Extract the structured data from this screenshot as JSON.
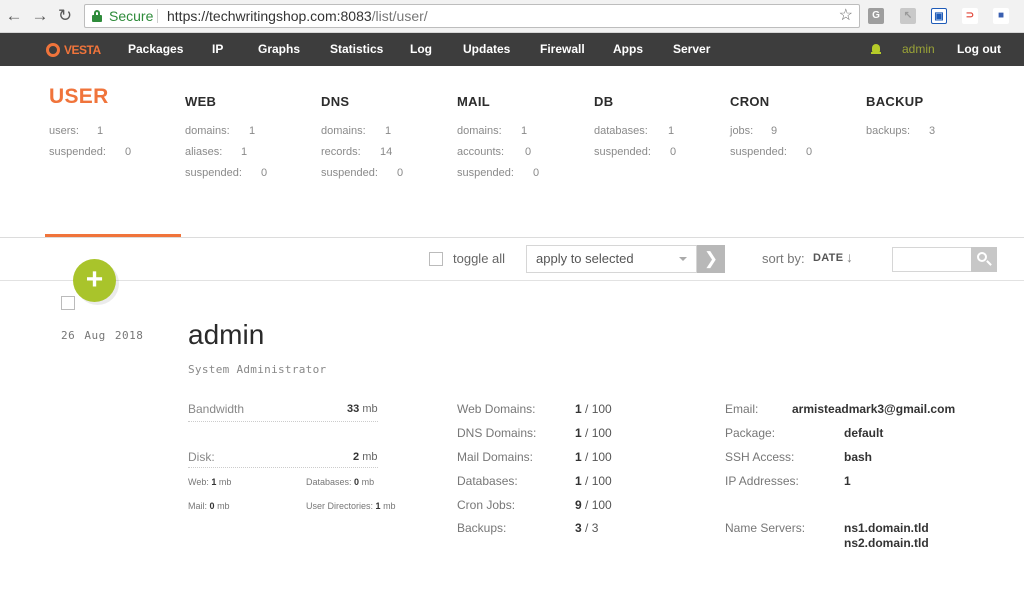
{
  "browser": {
    "secure_label": "Secure",
    "url_host": "https://techwritingshop.com:8083",
    "url_path": "/list/user/",
    "ext_icons": [
      "G",
      "↖",
      "▣",
      "⊃",
      "■"
    ]
  },
  "nav": {
    "logo": "VESTA",
    "items": [
      "Packages",
      "IP",
      "Graphs",
      "Statistics",
      "Log",
      "Updates",
      "Firewall",
      "Apps",
      "Server"
    ],
    "user": "admin",
    "logout": "Log out"
  },
  "stats": {
    "user": {
      "title": "USER",
      "rows": [
        {
          "label": "users:",
          "value": "1"
        },
        {
          "label": "suspended:",
          "value": "0"
        }
      ]
    },
    "web": {
      "title": "WEB",
      "rows": [
        {
          "label": "domains:",
          "value": "1"
        },
        {
          "label": "aliases:",
          "value": "1"
        },
        {
          "label": "suspended:",
          "value": "0"
        }
      ]
    },
    "dns": {
      "title": "DNS",
      "rows": [
        {
          "label": "domains:",
          "value": "1"
        },
        {
          "label": "records:",
          "value": "14"
        },
        {
          "label": "suspended:",
          "value": "0"
        }
      ]
    },
    "mail": {
      "title": "MAIL",
      "rows": [
        {
          "label": "domains:",
          "value": "1"
        },
        {
          "label": "accounts:",
          "value": "0"
        },
        {
          "label": "suspended:",
          "value": "0"
        }
      ]
    },
    "db": {
      "title": "DB",
      "rows": [
        {
          "label": "databases:",
          "value": "1"
        },
        {
          "label": "suspended:",
          "value": "0"
        }
      ]
    },
    "cron": {
      "title": "CRON",
      "rows": [
        {
          "label": "jobs:",
          "value": "9"
        },
        {
          "label": "suspended:",
          "value": "0"
        }
      ]
    },
    "backup": {
      "title": "BACKUP",
      "rows": [
        {
          "label": "backups:",
          "value": "3"
        }
      ]
    }
  },
  "toolbar": {
    "toggle_all": "toggle all",
    "apply_select": "apply to selected",
    "sort_label": "sort by:",
    "sort_value": "DATE",
    "sort_arrow": "↓"
  },
  "record": {
    "date": "26 Aug 2018",
    "username": "admin",
    "fullname": "System Administrator",
    "bandwidth": {
      "label": "Bandwidth",
      "value": "33",
      "unit": "mb"
    },
    "disk": {
      "label": "Disk:",
      "value": "2",
      "unit": "mb"
    },
    "disk_breakdown": {
      "web": {
        "label": "Web:",
        "value": "1",
        "unit": "mb"
      },
      "databases": {
        "label": "Databases:",
        "value": "0",
        "unit": "mb"
      },
      "mail": {
        "label": "Mail:",
        "value": "0",
        "unit": "mb"
      },
      "user_dirs": {
        "label": "User Directories:",
        "value": "1",
        "unit": "mb"
      }
    },
    "limits": [
      {
        "label": "Web Domains:",
        "used": "1",
        "total": "/ 100"
      },
      {
        "label": "DNS Domains:",
        "used": "1",
        "total": "/ 100"
      },
      {
        "label": "Mail Domains:",
        "used": "1",
        "total": "/ 100"
      },
      {
        "label": "Databases:",
        "used": "1",
        "total": "/ 100"
      },
      {
        "label": "Cron Jobs:",
        "used": "9",
        "total": "/ 100"
      },
      {
        "label": "Backups:",
        "used": "3",
        "total": "/ 3"
      }
    ],
    "info": {
      "email": {
        "label": "Email:",
        "value": "armisteadmark3@gmail.com"
      },
      "package": {
        "label": "Package:",
        "value": "default"
      },
      "ssh": {
        "label": "SSH Access:",
        "value": "bash"
      },
      "ip": {
        "label": "IP Addresses:",
        "value": "1"
      },
      "ns": {
        "label": "Name Servers:",
        "values": [
          "ns1.domain.tld",
          "ns2.domain.tld"
        ]
      }
    }
  }
}
